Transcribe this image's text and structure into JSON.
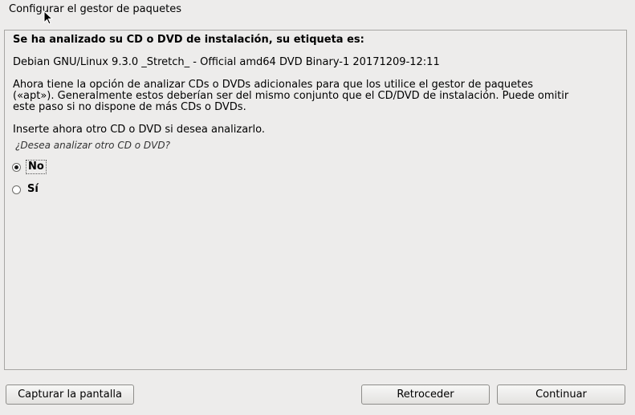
{
  "page_title": "Configurar el gestor de paquetes",
  "panel": {
    "analyzed_label": "Se ha analizado su CD o DVD de instalación, su etiqueta es:",
    "disc_label": "Debian GNU/Linux 9.3.0 _Stretch_ - Official amd64 DVD Binary-1 20171209-12:11",
    "description_lines": [
      "Ahora tiene la opción de analizar CDs o DVDs adicionales para que los utilice el gestor de paquetes",
      "(«apt»). Generalmente estos deberían ser del mismo conjunto que el CD/DVD de instalación. Puede omitir",
      "este paso si no dispone de más CDs o DVDs."
    ],
    "insert_instruction": "Inserte ahora otro CD o DVD si desea analizarlo.",
    "question": "¿Desea analizar otro CD o DVD?",
    "options": [
      {
        "label": "No",
        "selected": true
      },
      {
        "label": "Sí",
        "selected": false
      }
    ]
  },
  "buttons": {
    "screenshot": "Capturar la pantalla",
    "back": "Retroceder",
    "continue": "Continuar"
  },
  "icons": {
    "cursor": "mouse-pointer-icon"
  }
}
